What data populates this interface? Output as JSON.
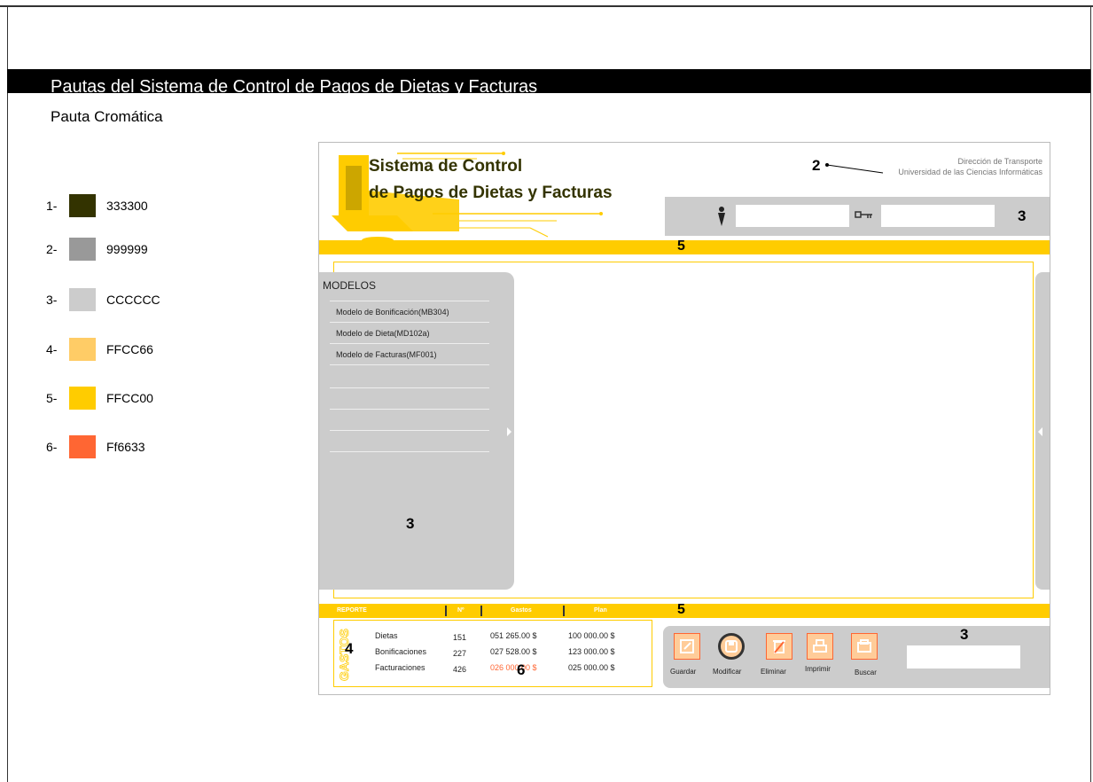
{
  "document": {
    "title": "Pautas del Sistema de Control de Pagos de Dietas y Facturas",
    "subtitle": "Pauta Cromática"
  },
  "palette": [
    {
      "num": "1-",
      "hex": "333300",
      "color": "#333300"
    },
    {
      "num": "2-",
      "hex": "999999",
      "color": "#999999"
    },
    {
      "num": "3-",
      "hex": "CCCCCC",
      "color": "#CCCCCC"
    },
    {
      "num": "4-",
      "hex": "FFCC66",
      "color": "#FFCC66"
    },
    {
      "num": "5-",
      "hex": "FFCC00",
      "color": "#FFCC00"
    },
    {
      "num": "6-",
      "hex": "Ff6633",
      "color": "#FF6633"
    }
  ],
  "app": {
    "title_line1": "Sistema de Control",
    "title_line2": "de Pagos de Dietas y Facturas",
    "org_line1": "Dirección de Transporte",
    "org_line2": "Universidad de las Ciencias Informáticas"
  },
  "callouts": {
    "header_org": "2",
    "login_panel": "3",
    "top_bar": "5",
    "side_menu": "3",
    "report_bar": "5",
    "report_box": "4",
    "red_value": "6",
    "bottom_panel": "3"
  },
  "login": {
    "user_icon": "user-icon",
    "key_icon": "key-icon",
    "user_value": "",
    "password_value": ""
  },
  "menu": {
    "title": "MODELOS",
    "items": [
      "Modelo de Bonificación(MB304)",
      "Modelo de Dieta(MD102a)",
      "Modelo de Facturas(MF001)"
    ]
  },
  "report": {
    "headers": [
      "REPORTE",
      "Nº",
      "Gastos",
      "Plan"
    ],
    "side_label": "GASTOS",
    "rows": [
      {
        "concept": "Dietas",
        "count": "151",
        "spent": "051 265.00 $",
        "plan": "100 000.00 $"
      },
      {
        "concept": "Bonificaciones",
        "count": "227",
        "spent": "027 528.00 $",
        "plan": "123 000.00 $"
      },
      {
        "concept": "Facturaciones",
        "count": "426",
        "spent": "026 000.00 $",
        "plan": "025 000.00 $"
      }
    ]
  },
  "actions": [
    {
      "label": "Guardar",
      "icon": "save-edit-icon"
    },
    {
      "label": "Modificar",
      "icon": "modify-disk-icon"
    },
    {
      "label": "Eliminar",
      "icon": "trash-icon"
    },
    {
      "label": "Imprimir",
      "icon": "printer-icon"
    },
    {
      "label": "Buscar",
      "icon": "search-folder-icon"
    }
  ],
  "colors": {
    "accent": "#FFCC00",
    "panel": "#CCCCCC",
    "brand_dark": "#333300",
    "alert": "#FF6633"
  }
}
